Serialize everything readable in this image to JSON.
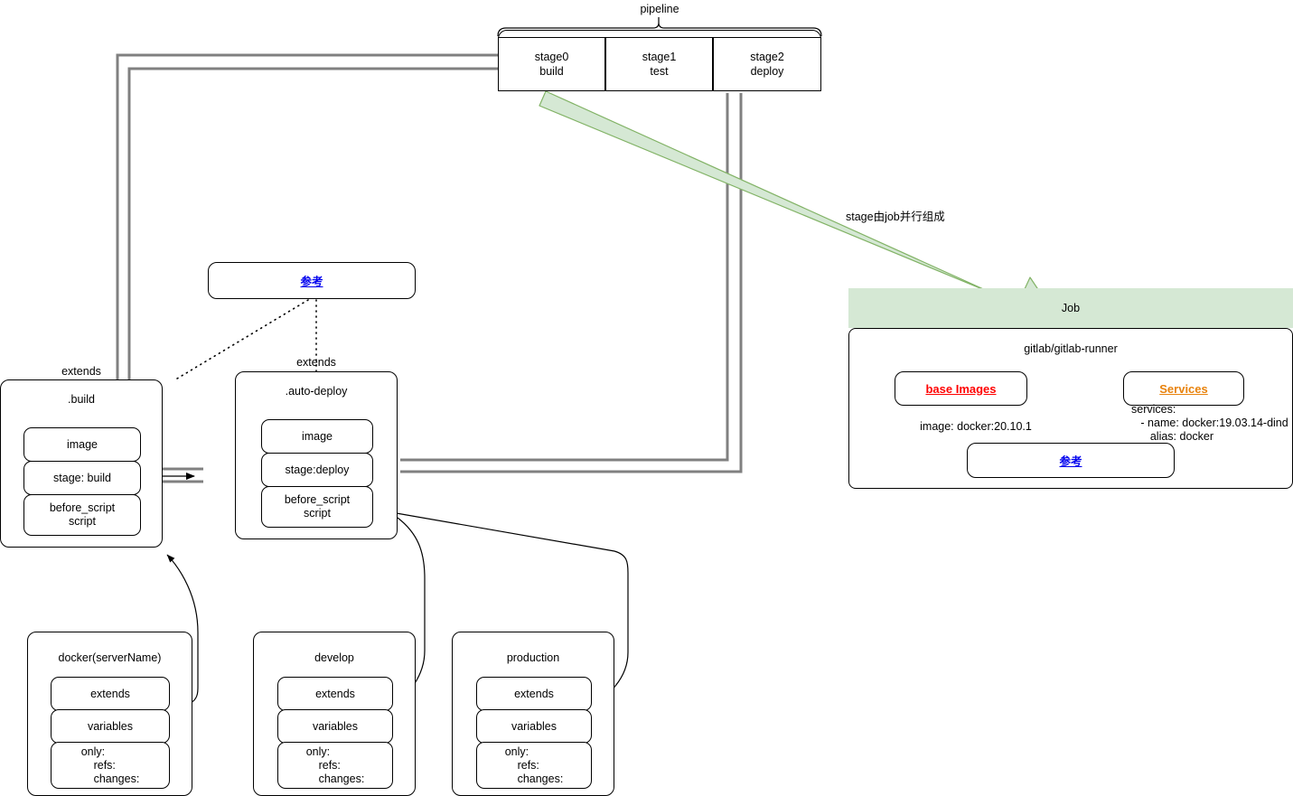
{
  "diagram": {
    "title_labels": {
      "pipeline": "pipeline",
      "extends_build": "extends",
      "extends_autodeploy": "extends",
      "green_arrow_label": "stage由job并行组成"
    },
    "pipeline": {
      "stages": [
        {
          "id": "stage0",
          "name": "stage0",
          "job": "build"
        },
        {
          "id": "stage1",
          "name": "stage1",
          "job": "test"
        },
        {
          "id": "stage2",
          "name": "stage2",
          "job": "deploy"
        }
      ]
    },
    "reference_box": {
      "label": "参考"
    },
    "templates": [
      {
        "id": "build",
        "title": ".build",
        "rows": [
          "image",
          "stage: build",
          "before_script\nscript"
        ]
      },
      {
        "id": "auto-deploy",
        "title": ".auto-deploy",
        "rows": [
          "image",
          "stage:deploy",
          "before_script\nscript"
        ]
      }
    ],
    "jobs": [
      {
        "id": "docker",
        "title": "docker(serverName)",
        "rows": [
          "extends",
          "variables",
          "only:\n    refs:\n    changes:"
        ]
      },
      {
        "id": "develop",
        "title": "develop",
        "rows": [
          "extends",
          "variables",
          "only:\n    refs:\n    changes:"
        ]
      },
      {
        "id": "production",
        "title": "production",
        "rows": [
          "extends",
          "variables",
          "only:\n    refs:\n    changes:"
        ]
      }
    ],
    "job_panel": {
      "header": "Job",
      "runner": "gitlab/gitlab-runner",
      "base_images": {
        "label": "base Images",
        "caption": "image: docker:20.10.1"
      },
      "services": {
        "label": "Services",
        "caption": "services:\n   - name: docker:19.03.14-dind\n      alias: docker"
      },
      "reference": "参考"
    },
    "colors": {
      "green_fill": "#d5e8d4",
      "green_stroke": "#82b366",
      "gray_connector": "#808080",
      "link_blue": "#0000ee",
      "link_red": "#ff0000",
      "link_orange": "#e8820c"
    }
  }
}
